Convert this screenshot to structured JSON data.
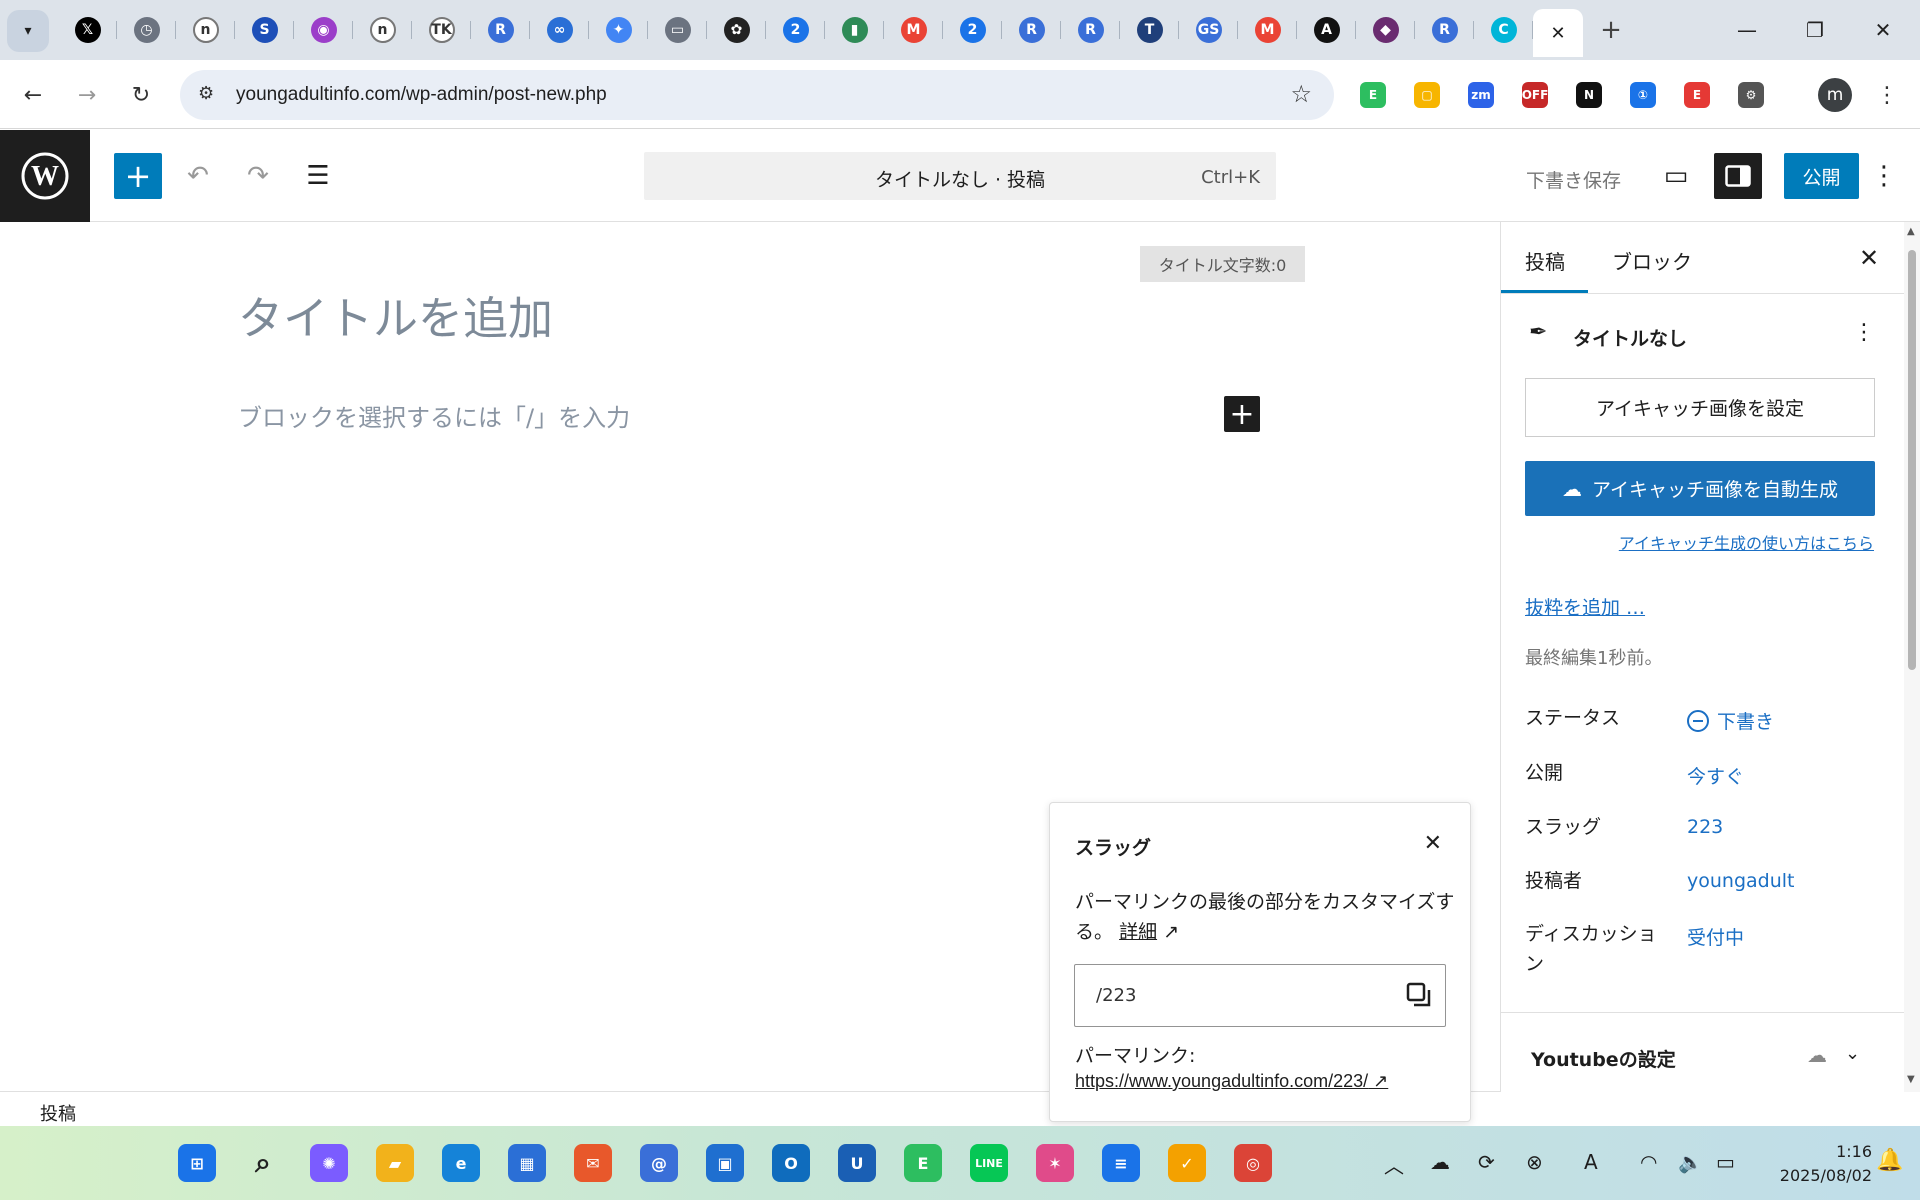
{
  "browser": {
    "tabs": [
      {
        "icon": "x-icon",
        "color": "#000000",
        "glyph": "𝕏"
      },
      {
        "icon": "clock-icon",
        "color": "#6b7380",
        "glyph": "◷"
      },
      {
        "icon": "note-icon",
        "color": "#ffffff",
        "glyph": "n"
      },
      {
        "icon": "swirl-icon",
        "color": "#1d4fb8",
        "glyph": "S"
      },
      {
        "icon": "podcast-icon",
        "color": "#9b3ec9",
        "glyph": "◉"
      },
      {
        "icon": "note-icon",
        "color": "#ffffff",
        "glyph": "n"
      },
      {
        "icon": "tk-icon",
        "color": "#ffffff",
        "glyph": "TK"
      },
      {
        "icon": "r-icon",
        "color": "#3a6fd8",
        "glyph": "R"
      },
      {
        "icon": "infinity-icon",
        "color": "#2a6fd6",
        "glyph": "∞"
      },
      {
        "icon": "gemini-icon",
        "color": "#4285f4",
        "glyph": "✦"
      },
      {
        "icon": "monitor-icon",
        "color": "#6b7380",
        "glyph": "▭"
      },
      {
        "icon": "openai-icon",
        "color": "#222222",
        "glyph": "✿"
      },
      {
        "icon": "calendar-icon",
        "color": "#1a73e8",
        "glyph": "2"
      },
      {
        "icon": "book-icon",
        "color": "#2e8b57",
        "glyph": "▮"
      },
      {
        "icon": "gmail-icon",
        "color": "#ea4335",
        "glyph": "M"
      },
      {
        "icon": "calendar-icon",
        "color": "#1a73e8",
        "glyph": "2"
      },
      {
        "icon": "r-icon",
        "color": "#3a6fd8",
        "glyph": "R"
      },
      {
        "icon": "r-icon",
        "color": "#3a6fd8",
        "glyph": "R"
      },
      {
        "icon": "t-icon",
        "color": "#1f3f7a",
        "glyph": "T"
      },
      {
        "icon": "gs-icon",
        "color": "#3a6fd8",
        "glyph": "GS"
      },
      {
        "icon": "gmail-icon",
        "color": "#ea4335",
        "glyph": "M"
      },
      {
        "icon": "a-icon",
        "color": "#111111",
        "glyph": "A"
      },
      {
        "icon": "dog-icon",
        "color": "#6a2c70",
        "glyph": "◆"
      },
      {
        "icon": "r-icon",
        "color": "#3a6fd8",
        "glyph": "R"
      },
      {
        "icon": "canva-icon",
        "color": "#00b5d8",
        "glyph": "C"
      }
    ],
    "url": "youngadultinfo.com/wp-admin/post-new.php",
    "extensions": [
      {
        "icon": "evernote-icon",
        "color": "#2dbe60",
        "glyph": "E"
      },
      {
        "icon": "keep-icon",
        "color": "#f7b500",
        "glyph": "▢"
      },
      {
        "icon": "zoom-icon",
        "color": "#2d63e8",
        "glyph": "zm"
      },
      {
        "icon": "off-icon",
        "color": "#c62828",
        "glyph": "OFF"
      },
      {
        "icon": "notion-icon",
        "color": "#111111",
        "glyph": "N"
      },
      {
        "icon": "onepassword-icon",
        "color": "#1a73e8",
        "glyph": "①"
      },
      {
        "icon": "e-icon",
        "color": "#e53935",
        "glyph": "E"
      },
      {
        "icon": "puzzle-icon",
        "color": "#555555",
        "glyph": "⚙"
      }
    ],
    "profile": "m"
  },
  "wp": {
    "doc_title": "タイトルなし · 投稿",
    "shortcut": "Ctrl+K",
    "save_draft": "下書き保存",
    "publish": "公開"
  },
  "editor": {
    "char_count": "タイトル文字数:0",
    "title_placeholder": "タイトルを追加",
    "block_placeholder": "ブロックを選択するには「/」を入力"
  },
  "slug_popover": {
    "heading": "スラッグ",
    "help": "パーマリンクの最後の部分をカスタマイズする。",
    "details_link": "詳細",
    "value": "/223",
    "permalink_label": "パーマリンク:",
    "permalink_url": "https://www.youngadultinfo.com/223/"
  },
  "footer": {
    "breadcrumb": "投稿"
  },
  "sidebar": {
    "tab_post": "投稿",
    "tab_block": "ブロック",
    "post_title": "タイトルなし",
    "featured_button": "アイキャッチ画像を設定",
    "autogen_button": "アイキャッチ画像を自動生成",
    "howto_link": "アイキャッチ生成の使い方はこちら",
    "excerpt_link": "抜粋を追加 …",
    "last_edited": "最終編集1秒前。",
    "meta": {
      "status_label": "ステータス",
      "status_value": "下書き",
      "publish_label": "公開",
      "publish_value": "今すぐ",
      "slug_label": "スラッグ",
      "slug_value": "223",
      "author_label": "投稿者",
      "author_value": "youngadult",
      "discussion_label": "ディスカッション",
      "discussion_value": "受付中"
    },
    "youtube_section": "Youtubeの設定"
  },
  "taskbar": {
    "apps": [
      {
        "icon": "windows-start-icon",
        "color": "#1a73e8",
        "glyph": "⊞"
      },
      {
        "icon": "search-icon",
        "color": "#222222",
        "glyph": "⌕"
      },
      {
        "icon": "copilot-icon",
        "color": "#7b5cff",
        "glyph": "✺"
      },
      {
        "icon": "file-explorer-icon",
        "color": "#f2b21b",
        "glyph": "▰"
      },
      {
        "icon": "edge-icon",
        "color": "#1583d8",
        "glyph": "e"
      },
      {
        "icon": "store-icon",
        "color": "#2b6fd6",
        "glyph": "▦"
      },
      {
        "icon": "thunderbird-icon",
        "color": "#e8582b",
        "glyph": "✉"
      },
      {
        "icon": "mail-at-icon",
        "color": "#3a6fd8",
        "glyph": "@"
      },
      {
        "icon": "photo-icon",
        "color": "#1f6fd0",
        "glyph": "▣"
      },
      {
        "icon": "outlook-icon",
        "color": "#0f6cbd",
        "glyph": "O"
      },
      {
        "icon": "u-app-icon",
        "color": "#1a5fb4",
        "glyph": "U"
      },
      {
        "icon": "evernote-icon",
        "color": "#2dbe60",
        "glyph": "E"
      },
      {
        "icon": "line-icon",
        "color": "#06c755",
        "glyph": "LINE"
      },
      {
        "icon": "pinwheel-icon",
        "color": "#e04b8a",
        "glyph": "✶"
      },
      {
        "icon": "notepad-icon",
        "color": "#1a73e8",
        "glyph": "≡"
      },
      {
        "icon": "check-icon",
        "color": "#f4a100",
        "glyph": "✓"
      },
      {
        "icon": "chrome-icon",
        "color": "#db4437",
        "glyph": "◎"
      }
    ],
    "tray": [
      {
        "icon": "chevron-up-icon",
        "glyph": "︿"
      },
      {
        "icon": "onedrive-icon",
        "glyph": "☁"
      },
      {
        "icon": "sync-icon",
        "glyph": "⟳"
      },
      {
        "icon": "x-circle-icon",
        "glyph": "⊗"
      },
      {
        "icon": "a-font-icon",
        "glyph": "A"
      },
      {
        "icon": "wifi-icon",
        "glyph": "◠"
      },
      {
        "icon": "volume-icon",
        "glyph": "🔈"
      },
      {
        "icon": "battery-icon",
        "glyph": "▭"
      }
    ],
    "time": "1:16",
    "date": "2025/08/02"
  },
  "colors": {
    "wp_blue": "#007cba",
    "link_blue": "#1b6fc4",
    "dark": "#1e1e1e"
  }
}
